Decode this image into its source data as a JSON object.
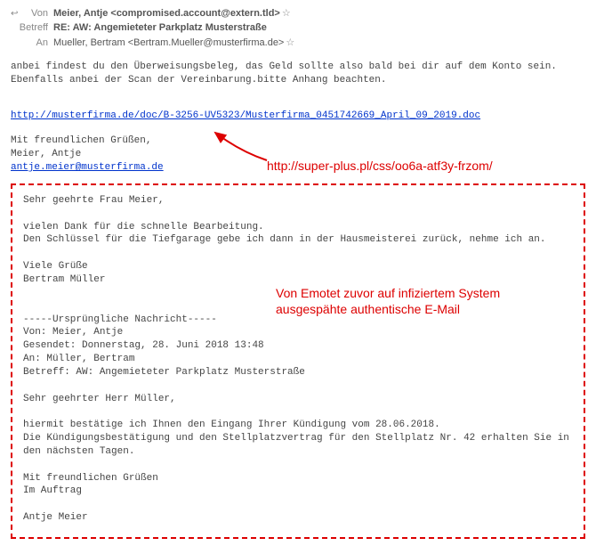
{
  "header": {
    "from_label": "Von",
    "from_value": "Meier, Antje <compromised.account@extern.tld>",
    "subject_label": "Betreff",
    "subject_value": "RE: AW: Angemieteter Parkplatz Musterstraße",
    "to_label": "An",
    "to_value": "Mueller, Bertram <Bertram.Mueller@musterfirma.de>"
  },
  "body": {
    "intro": "anbei findest du den Überweisungsbeleg, das Geld sollte also bald bei dir auf dem Konto sein.\nEbenfalls anbei der Scan der Vereinbarung.bitte Anhang beachten.",
    "link_text": "http://musterfirma.de/doc/B-3256-UV5323/Musterfirma_0451742669_April_09_2019.doc",
    "sig_line1": "Mit freundlichen Grüßen,",
    "sig_line2": "Meier, Antje",
    "sig_email": "antje.meier@musterfirma.de"
  },
  "quoted": {
    "greeting": "Sehr geehrte Frau Meier,",
    "thanks": "vielen Dank für die schnelle Bearbeitung.\nDen Schlüssel für die Tiefgarage gebe ich dann in der Hausmeisterei zurück, nehme ich an.",
    "closing1": "Viele Grüße\nBertram Müller",
    "orig_header": "-----Ursprüngliche Nachricht-----\nVon: Meier, Antje\nGesendet: Donnerstag, 28. Juni 2018 13:48\nAn: Müller, Bertram\nBetreff: AW: Angemieteter Parkplatz Musterstraße",
    "orig_greeting": "Sehr geehrter Herr Müller,",
    "orig_body": "hiermit bestätige ich Ihnen den Eingang Ihrer Kündigung vom 28.06.2018.\nDie Kündigungsbestätigung und den Stellplatzvertrag für den Stellplatz Nr. 42 erhalten Sie in den nächsten Tagen.",
    "orig_closing": "Mit freundlichen Grüßen\nIm Auftrag",
    "orig_name": "Antje Meier"
  },
  "annotation": {
    "real_url": "http://super-plus.pl/css/oo6a-atf3y-frzom/",
    "note_line1": "Von Emotet zuvor auf infiziertem System",
    "note_line2": "ausgespähte authentische E-Mail"
  },
  "icons": {
    "star": "☆",
    "reply": "↩"
  }
}
